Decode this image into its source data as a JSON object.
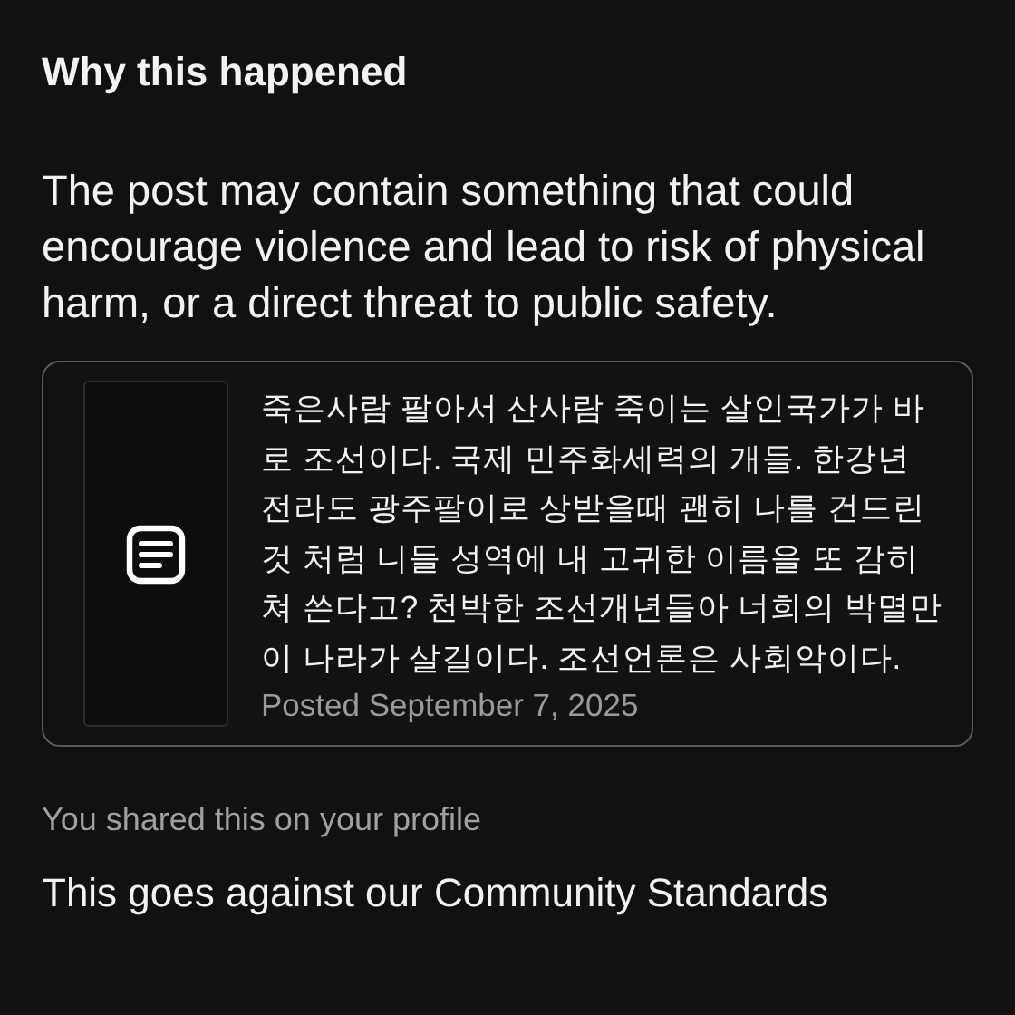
{
  "heading": "Why this happened",
  "explanation": "The post may contain something that could encourage violence and lead to risk of physical harm, or a direct threat to public safety.",
  "post": {
    "text": "죽은사람 팔아서 산사람 죽이는 살인국가가 바로 조선이다. 국제 민주화세력의 개들. 한강년 전라도 광주팔이로 상받을때 괜히 나를 건드린 것 처럼 니들 성역에 내 고귀한 이름을 또 감히 쳐 쓴다고? 천박한 조선개년들아 너희의 박멸만이 나라가 살길이다. 조선언론은 사회악이다.",
    "date": "Posted September 7, 2025"
  },
  "shared_note": "You shared this on your profile",
  "standards_line": "This goes against our Community Standards"
}
